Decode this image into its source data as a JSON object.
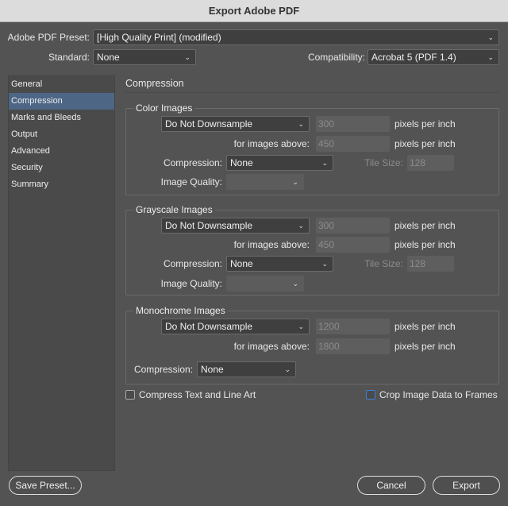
{
  "title": "Export Adobe PDF",
  "preset": {
    "label": "Adobe PDF Preset:",
    "value": "[High Quality Print] (modified)"
  },
  "standard": {
    "label": "Standard:",
    "value": "None"
  },
  "compatibility": {
    "label": "Compatibility:",
    "value": "Acrobat 5 (PDF 1.4)"
  },
  "sidebar": {
    "items": [
      {
        "label": "General"
      },
      {
        "label": "Compression"
      },
      {
        "label": "Marks and Bleeds"
      },
      {
        "label": "Output"
      },
      {
        "label": "Advanced"
      },
      {
        "label": "Security"
      },
      {
        "label": "Summary"
      }
    ],
    "selected": "Compression"
  },
  "heading": "Compression",
  "common": {
    "ppi": "pixels per inch",
    "above": "for images above:",
    "compression": "Compression:",
    "tile": "Tile Size:",
    "quality": "Image Quality:"
  },
  "color": {
    "title": "Color Images",
    "downsample": "Do Not Downsample",
    "ppi": "300",
    "above": "450",
    "compression": "None",
    "tile": "128"
  },
  "gray": {
    "title": "Grayscale Images",
    "downsample": "Do Not Downsample",
    "ppi": "300",
    "above": "450",
    "compression": "None",
    "tile": "128"
  },
  "mono": {
    "title": "Monochrome Images",
    "downsample": "Do Not Downsample",
    "ppi": "1200",
    "above": "1800",
    "compression": "None"
  },
  "options": {
    "compress_text": "Compress Text and Line Art",
    "crop": "Crop Image Data to Frames"
  },
  "buttons": {
    "save_preset": "Save Preset...",
    "cancel": "Cancel",
    "export": "Export"
  }
}
